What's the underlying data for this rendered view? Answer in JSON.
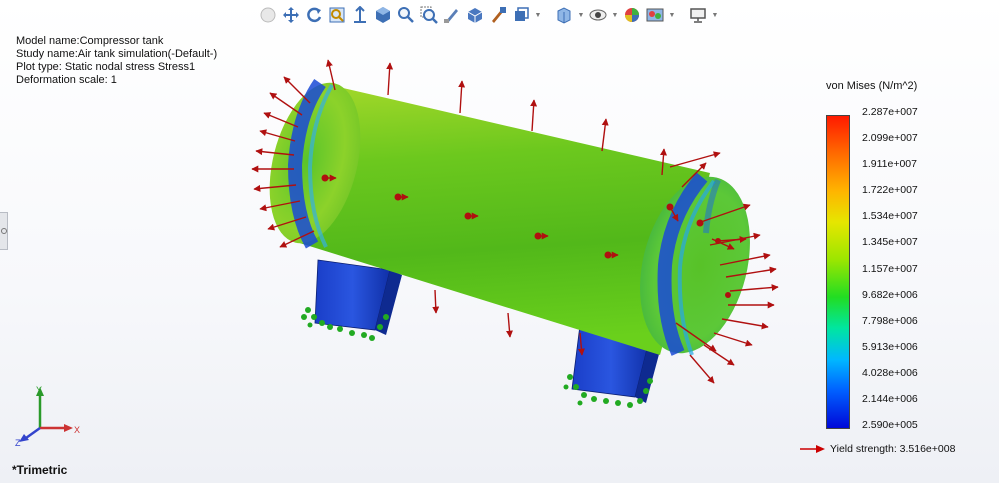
{
  "info": {
    "model_name": "Model name:Compressor tank",
    "study_name": "Study name:Air tank simulation(-Default-)",
    "plot_type": "Plot type: Static nodal stress Stress1",
    "deformation_scale": "Deformation scale: 1"
  },
  "legend": {
    "title": "von Mises (N/m^2)",
    "labels": [
      "2.287e+007",
      "2.099e+007",
      "1.911e+007",
      "1.722e+007",
      "1.534e+007",
      "1.345e+007",
      "1.157e+007",
      "9.682e+006",
      "7.798e+006",
      "5.913e+006",
      "4.028e+006",
      "2.144e+006",
      "2.590e+005"
    ],
    "yield_label": "Yield strength: 3.516e+008",
    "yield_color": "#cc0000"
  },
  "view": {
    "label": "*Trimetric"
  },
  "triad": {
    "x": "X",
    "y": "Y",
    "z": "Z"
  },
  "toolbar": {
    "icons": [
      "display-style-icon",
      "move-icon",
      "rotate-icon",
      "zoom-to-fit-icon",
      "zoom-area-icon",
      "view-orientation-icon",
      "standard-views-icon",
      "zoom-in-icon",
      "zoom-out-icon",
      "edit-appearance-icon",
      "section-view-icon",
      "dynamic-annotation-icon",
      "display-type-icon",
      "hide-show-icon",
      "view-settings-icon",
      "apply-scene-icon",
      "edit-scene-icon",
      "monitor-icon"
    ]
  },
  "colors": {
    "arrow": "#b01010",
    "restraint": "#22aa22",
    "tank": "#4cc61a",
    "cap": "#1a4ad6"
  }
}
